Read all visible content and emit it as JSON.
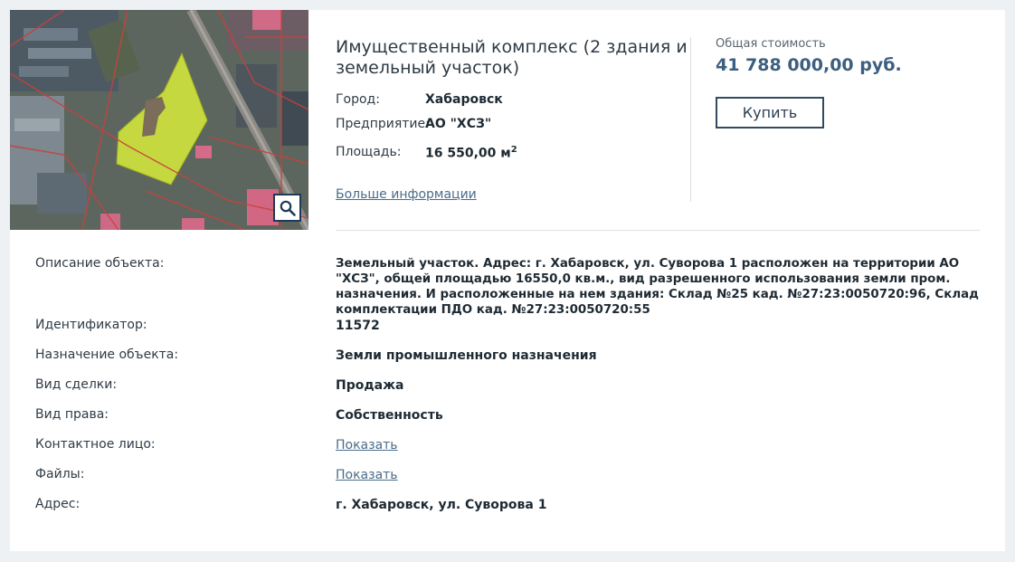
{
  "listing": {
    "title": "Имущественный комплекс (2 здания и земельный участок)",
    "specs": [
      {
        "label": "Город:",
        "value": "Хабаровск"
      },
      {
        "label": "Предприятие:",
        "value": "АО \"ХСЗ\""
      },
      {
        "label": "Площадь:",
        "value": "16 550,00 м",
        "unit_sup": "2"
      }
    ],
    "more_link": "Больше информации",
    "price_label": "Общая стоимость",
    "price_value": "41 788 000,00 руб.",
    "buy_label": "Купить",
    "zoom_icon": "magnifier-icon"
  },
  "details": [
    {
      "label": "Описание объекта:",
      "value": "Земельный участок. Адрес: г. Хабаровск, ул. Суворова 1 расположен на территории АО \"ХСЗ\", общей площадью 16550,0 кв.м., вид разрешенного использования земли пром. назначения. И расположенные на нем здания: Склад №25 кад. №27:23:0050720:96, Склад комплектации ПДО кад. №27:23:0050720:55"
    },
    {
      "label": "Идентификатор:",
      "value": "11572"
    },
    {
      "label": "Назначение объекта:",
      "value": "Земли промышленного назначения"
    },
    {
      "label": "Вид сделки:",
      "value": "Продажа"
    },
    {
      "label": "Вид права:",
      "value": "Собственность"
    },
    {
      "label": "Контактное лицо:",
      "value": "Показать"
    },
    {
      "label": "Файлы:",
      "value": "Показать"
    },
    {
      "label": "Адрес:",
      "value": "г. Хабаровск, ул. Суворова 1"
    }
  ]
}
